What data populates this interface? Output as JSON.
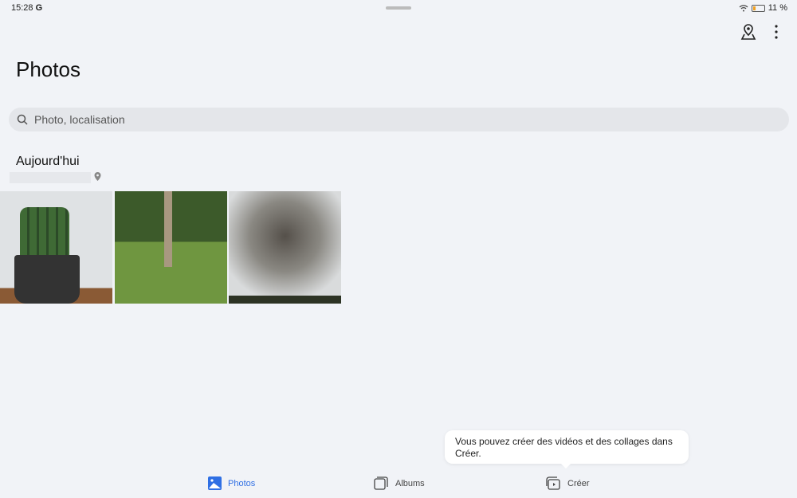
{
  "status": {
    "time": "15:28",
    "g": "G",
    "battery": "11 %",
    "battery_level": 0.11
  },
  "header": {
    "title": "Photos"
  },
  "search": {
    "placeholder": "Photo, localisation"
  },
  "section": {
    "title": "Aujourd'hui"
  },
  "photos": [
    {
      "subject": "cactus"
    },
    {
      "subject": "tree-lawn"
    },
    {
      "subject": "bare-tree"
    }
  ],
  "tooltip": {
    "text": "Vous pouvez créer des vidéos et des collages dans Créer."
  },
  "nav": {
    "photos": "Photos",
    "albums": "Albums",
    "create": "Créer"
  },
  "colors": {
    "accent": "#2f6fe4"
  }
}
